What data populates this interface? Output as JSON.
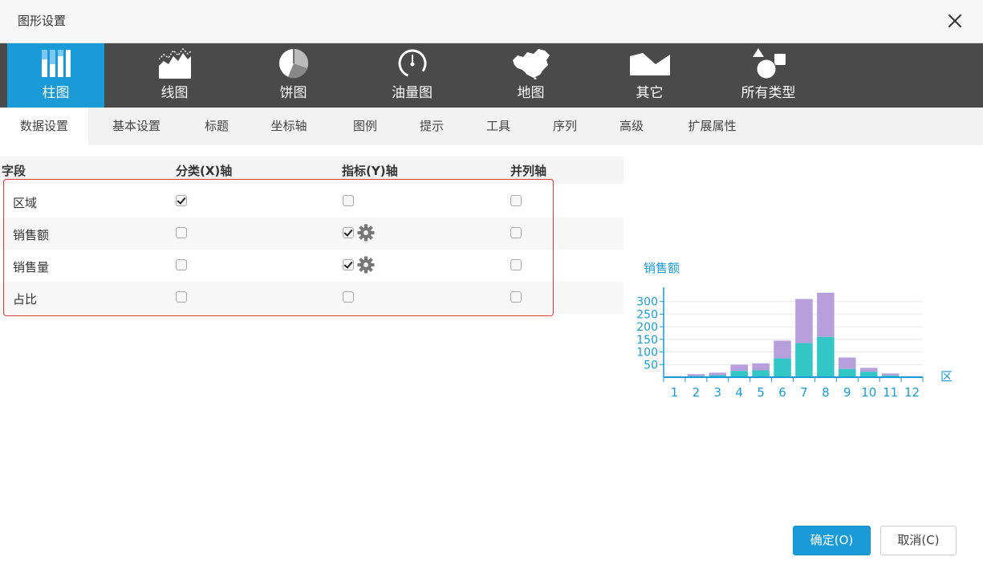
{
  "dialog": {
    "title": "图形设置"
  },
  "chart_types": [
    {
      "label": "柱图",
      "icon": "bar-chart-icon",
      "active": true
    },
    {
      "label": "线图",
      "icon": "line-chart-icon",
      "active": false
    },
    {
      "label": "饼图",
      "icon": "pie-chart-icon",
      "active": false
    },
    {
      "label": "油量图",
      "icon": "gauge-chart-icon",
      "active": false
    },
    {
      "label": "地图",
      "icon": "china-map-icon",
      "active": false
    },
    {
      "label": "其它",
      "icon": "other-chart-icon",
      "active": false
    },
    {
      "label": "所有类型",
      "icon": "all-types-icon",
      "active": false
    }
  ],
  "tabs": [
    {
      "label": "数据设置",
      "active": true
    },
    {
      "label": "基本设置",
      "active": false
    },
    {
      "label": "标题",
      "active": false
    },
    {
      "label": "坐标轴",
      "active": false
    },
    {
      "label": "图例",
      "active": false
    },
    {
      "label": "提示",
      "active": false
    },
    {
      "label": "工具",
      "active": false
    },
    {
      "label": "序列",
      "active": false
    },
    {
      "label": "高级",
      "active": false
    },
    {
      "label": "扩展属性",
      "active": false
    }
  ],
  "grid": {
    "headers": {
      "field": "字段",
      "x_axis": "分类(X)轴",
      "y_axis": "指标(Y)轴",
      "parallel": "并列轴"
    },
    "rows": [
      {
        "field": "区域",
        "x": true,
        "y": false,
        "parallel": false,
        "gear": false
      },
      {
        "field": "销售额",
        "x": false,
        "y": true,
        "parallel": false,
        "gear": true
      },
      {
        "field": "销售量",
        "x": false,
        "y": true,
        "parallel": false,
        "gear": true
      },
      {
        "field": "占比",
        "x": false,
        "y": false,
        "parallel": false,
        "gear": false
      }
    ]
  },
  "colors": {
    "accent": "#1a9bd7",
    "series_a": "#33c6c6",
    "series_b": "#b79fdc",
    "highlight": "#e53935"
  },
  "chart_data": {
    "type": "bar",
    "stacked": true,
    "title": "销售额",
    "xlabel": "区",
    "categories": [
      "1",
      "2",
      "3",
      "4",
      "5",
      "6",
      "7",
      "8",
      "9",
      "10",
      "11",
      "12"
    ],
    "series": [
      {
        "values": [
          2,
          5,
          8,
          25,
          27,
          75,
          135,
          160,
          33,
          22,
          7,
          2
        ]
      },
      {
        "values": [
          2,
          7,
          10,
          25,
          28,
          70,
          175,
          175,
          45,
          15,
          8,
          2
        ]
      }
    ],
    "y_ticks": [
      50,
      100,
      150,
      200,
      250,
      300
    ],
    "ylim": [
      0,
      350
    ],
    "grid": true
  },
  "buttons": {
    "ok": "确定(O)",
    "cancel": "取消(C)"
  }
}
